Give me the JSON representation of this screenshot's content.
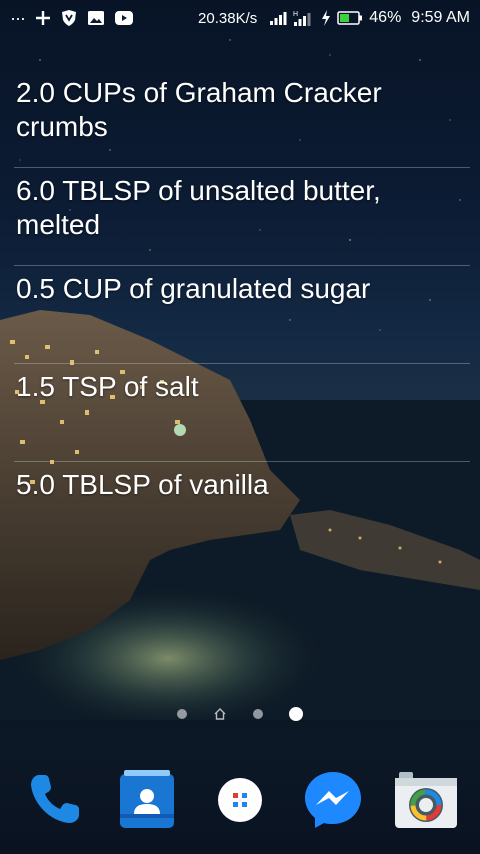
{
  "status_bar": {
    "more_indicator": "···",
    "network_speed": "20.38K/s",
    "battery_percent": "46%",
    "time": "9:59 AM",
    "icons": [
      "add-icon",
      "vpn-shield-icon",
      "gallery-icon",
      "youtube-icon",
      "signal-icon",
      "signal-h-icon",
      "charging-icon",
      "battery-icon"
    ]
  },
  "ingredients": [
    "2.0 CUPs of Graham Cracker crumbs",
    "6.0 TBLSP of unsalted butter, melted",
    "0.5 CUP of granulated sugar",
    "1.5 TSP of salt",
    "5.0 TBLSP of vanilla"
  ],
  "page_indicator": {
    "page_count": 3,
    "current_page": 3
  },
  "dock": {
    "apps": [
      "phone-icon",
      "contacts-icon",
      "app-drawer-icon",
      "messenger-icon",
      "camera-icon"
    ]
  },
  "colors": {
    "battery_fill": "#3cd03c",
    "phone_blue": "#1e88e5",
    "contacts_blue": "#1976d2",
    "messenger_blue": "#1e88ff"
  }
}
